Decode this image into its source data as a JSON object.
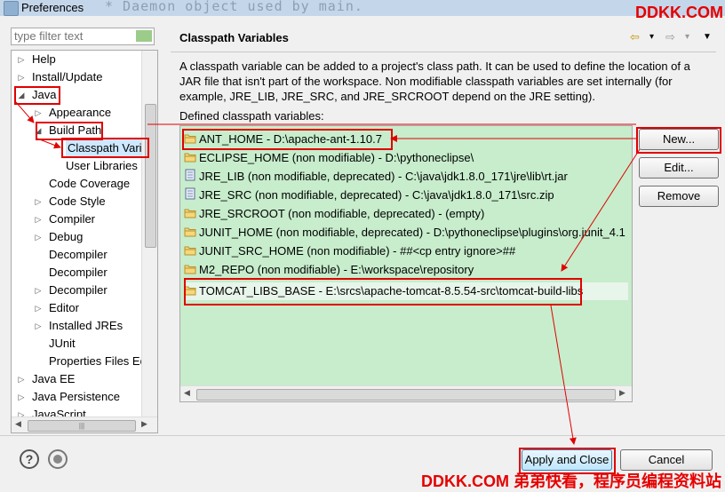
{
  "window": {
    "title": "Preferences",
    "ghost_text": "* Daemon object used by main."
  },
  "watermark": {
    "top": "DDKK.COM",
    "bottom": "DDKK.COM 弟弟快看，程序员编程资料站"
  },
  "filter": {
    "placeholder": "type filter text"
  },
  "tree": {
    "items": [
      {
        "label": "Help",
        "arrow": "▷"
      },
      {
        "label": "Install/Update",
        "arrow": "▷"
      },
      {
        "label": "Java",
        "arrow": "◢"
      },
      {
        "label": "Appearance",
        "arrow": "▷"
      },
      {
        "label": "Build Path",
        "arrow": "◢"
      },
      {
        "label": "Classpath Varia",
        "arrow": ""
      },
      {
        "label": "User Libraries",
        "arrow": ""
      },
      {
        "label": "Code Coverage",
        "arrow": ""
      },
      {
        "label": "Code Style",
        "arrow": "▷"
      },
      {
        "label": "Compiler",
        "arrow": "▷"
      },
      {
        "label": "Debug",
        "arrow": "▷"
      },
      {
        "label": "Decompiler",
        "arrow": ""
      },
      {
        "label": "Decompiler",
        "arrow": ""
      },
      {
        "label": "Decompiler",
        "arrow": "▷"
      },
      {
        "label": "Editor",
        "arrow": "▷"
      },
      {
        "label": "Installed JREs",
        "arrow": "▷"
      },
      {
        "label": "JUnit",
        "arrow": ""
      },
      {
        "label": "Properties Files Ed",
        "arrow": ""
      },
      {
        "label": "Java EE",
        "arrow": "▷"
      },
      {
        "label": "Java Persistence",
        "arrow": "▷"
      },
      {
        "label": "JavaScript",
        "arrow": "▷"
      }
    ]
  },
  "page": {
    "title": "Classpath Variables",
    "nav": {
      "back": "⇦",
      "forward": "⇨",
      "dropdown": "▾",
      "menu": "▼"
    },
    "description": "A classpath variable can be added to a project's class path. It can be used to define the location of a JAR file that isn't part of the workspace. Non modifiable classpath variables are set internally (for example, JRE_LIB, JRE_SRC, and JRE_SRCROOT depend on the JRE setting).",
    "list_label": "Defined classpath variables:",
    "variables": [
      {
        "text": "ANT_HOME - D:\\apache-ant-1.10.7",
        "icon": "folder-icon"
      },
      {
        "text": "ECLIPSE_HOME (non modifiable) - D:\\pythoneclipse\\",
        "icon": "folder-icon"
      },
      {
        "text": "JRE_LIB (non modifiable, deprecated) - C:\\java\\jdk1.8.0_171\\jre\\lib\\rt.jar",
        "icon": "jar-icon"
      },
      {
        "text": "JRE_SRC (non modifiable, deprecated) - C:\\java\\jdk1.8.0_171\\src.zip",
        "icon": "jar-icon"
      },
      {
        "text": "JRE_SRCROOT (non modifiable, deprecated) - (empty)",
        "icon": "folder-icon"
      },
      {
        "text": "JUNIT_HOME (non modifiable, deprecated) - D:\\pythoneclipse\\plugins\\org.junit_4.1",
        "icon": "folder-icon"
      },
      {
        "text": "JUNIT_SRC_HOME (non modifiable) - ##<cp entry ignore>##",
        "icon": "folder-icon"
      },
      {
        "text": "M2_REPO (non modifiable) - E:\\workspace\\repository",
        "icon": "folder-icon"
      },
      {
        "text": "TOMCAT_LIBS_BASE - E:\\srcs\\apache-tomcat-8.5.54-src\\tomcat-build-libs",
        "icon": "folder-icon"
      }
    ],
    "buttons": {
      "new": "New...",
      "edit": "Edit...",
      "remove": "Remove"
    }
  },
  "footer": {
    "apply_close": "Apply and Close",
    "cancel": "Cancel",
    "help": "?"
  },
  "colors": {
    "list_bg": "#c7edcc",
    "annotation_red": "#e00000",
    "watermark_red": "#e60000"
  }
}
